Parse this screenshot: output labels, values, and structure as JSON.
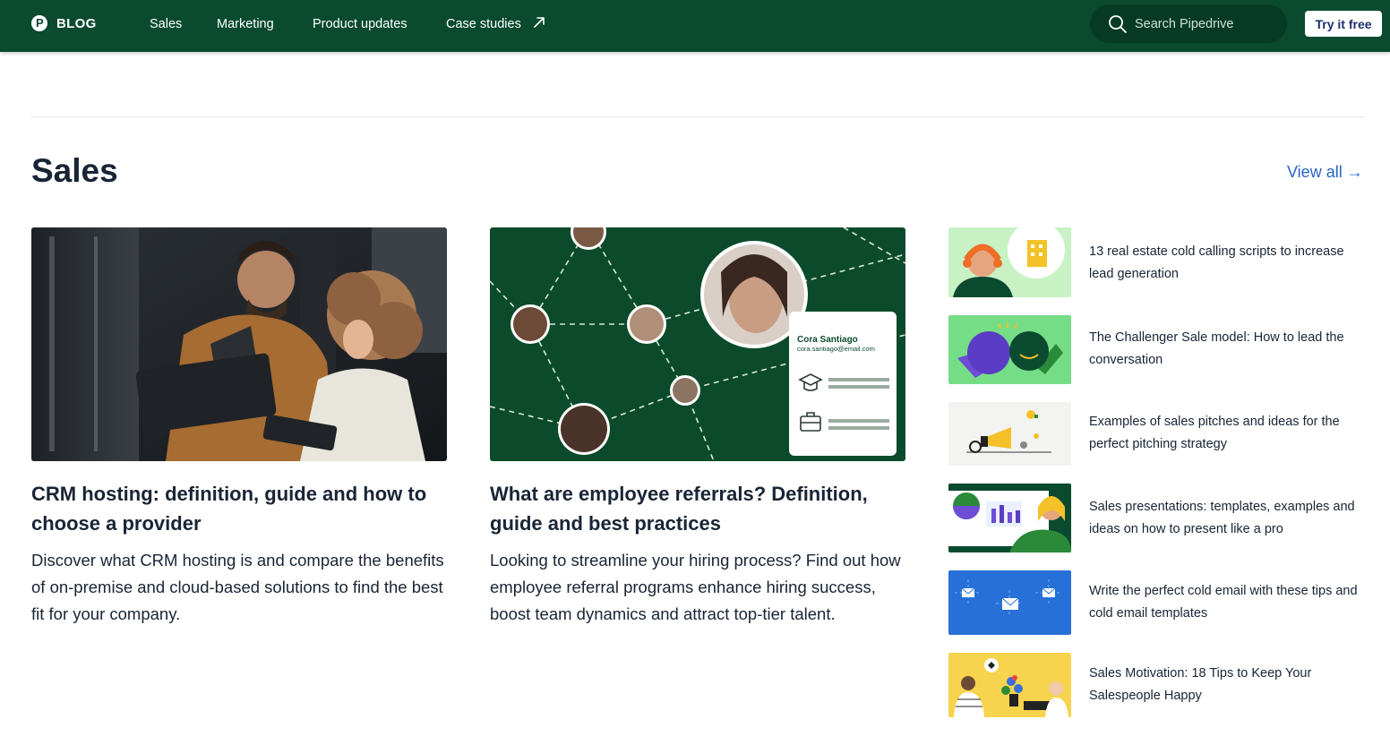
{
  "header": {
    "logo_letter": "P",
    "brand": "BLOG",
    "nav": [
      "Sales",
      "Marketing",
      "Product updates",
      "Case studies"
    ],
    "search_placeholder": "Search Pipedrive",
    "cta": "Try it free"
  },
  "section": {
    "title": "Sales",
    "view_all": "View all",
    "view_all_arrow": "→"
  },
  "featured": [
    {
      "title": "CRM hosting: definition, guide and how to choose a provider",
      "description": "Discover what CRM hosting is and compare the benefits of on-premise and cloud-based solutions to find the best fit for your company."
    },
    {
      "title": "What are employee referrals? Definition, guide and best practices",
      "description": "Looking to streamline your hiring process? Find out how employee referral programs enhance hiring success, boost team dynamics and attract top-tier talent.",
      "image_card": {
        "name": "Cora Santiago",
        "email": "cora.santiago@email.com"
      }
    }
  ],
  "sidebar_articles": [
    {
      "title": "13 real estate cold calling scripts to increase lead generation"
    },
    {
      "title": "The Challenger Sale model: How to lead the conversation"
    },
    {
      "title": "Examples of sales pitches and ideas for the perfect pitching strategy"
    },
    {
      "title": "Sales presentations: templates, examples and ideas on how to present like a pro"
    },
    {
      "title": "Write the perfect cold email with these tips and cold email templates"
    },
    {
      "title": "Sales Motivation: 18 Tips to Keep Your Salespeople Happy"
    }
  ],
  "colors": {
    "header_bg": "#0a4a2f",
    "link": "#2a63c8",
    "text": "#192435"
  },
  "icons": [
    "external-link-icon",
    "search-icon",
    "arrow-right-icon"
  ]
}
